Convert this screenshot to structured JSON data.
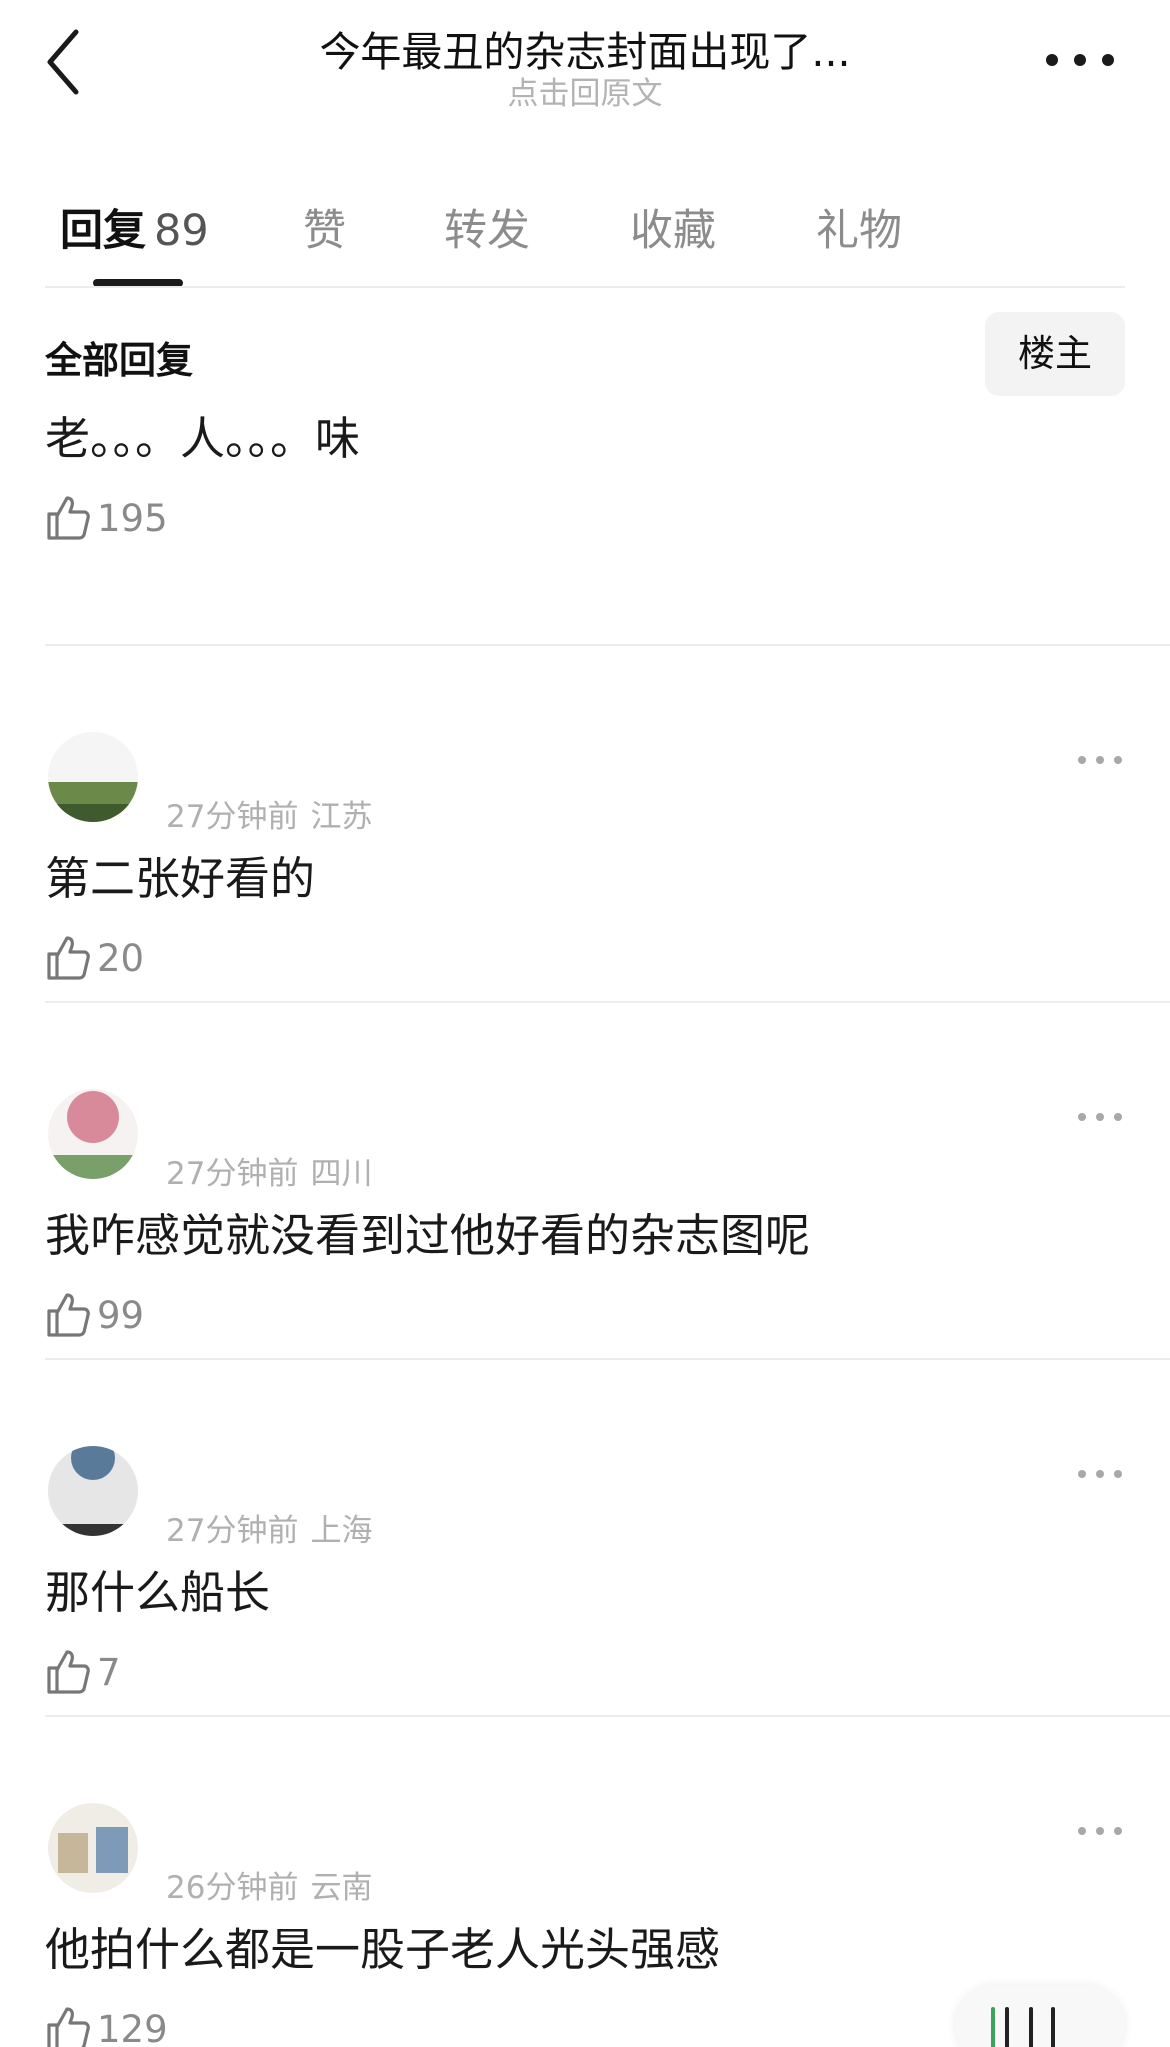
{
  "header": {
    "title": "今年最丑的杂志封面出现了...",
    "subtitle": "点击回原文"
  },
  "tabs": [
    {
      "label": "回复",
      "count": "89",
      "active": true
    },
    {
      "label": "赞"
    },
    {
      "label": "转发"
    },
    {
      "label": "收藏"
    },
    {
      "label": "礼物"
    }
  ],
  "section": {
    "title": "全部回复",
    "op_chip": "楼主"
  },
  "comments": [
    {
      "time": "",
      "location": "",
      "text": "老。。。人。。。味",
      "likes": "195",
      "avatar_colors": [
        "#2b2b2b",
        "#444444"
      ]
    },
    {
      "time": "27分钟前",
      "location": "江苏",
      "text": "第二张好看的",
      "likes": "20",
      "avatar_colors": [
        "#6b8a4a",
        "#3f5a2c"
      ]
    },
    {
      "time": "27分钟前",
      "location": "四川",
      "text": "我咋感觉就没看到过他好看的杂志图呢",
      "likes": "99",
      "avatar_colors": [
        "#d98a9a",
        "#7aa06a"
      ]
    },
    {
      "time": "27分钟前",
      "location": "上海",
      "text": "那什么船长",
      "likes": "7",
      "avatar_colors": [
        "#5a7a9a",
        "#e6e6e6"
      ]
    },
    {
      "time": "26分钟前",
      "location": "云南",
      "text": "他拍什么都是一股子老人光头强感",
      "likes": "129",
      "avatar_colors": [
        "#c7b79a",
        "#7d9ab8"
      ]
    }
  ],
  "colors": {
    "text_primary": "#1a1a1a",
    "text_secondary": "#8c8c8c",
    "meta": "#b0b0b0",
    "divider": "#ececec",
    "chip_bg": "#f3f3f3"
  },
  "icons": [
    "chevron-left-icon",
    "more-horizontal-icon",
    "thumbs-up-icon"
  ]
}
